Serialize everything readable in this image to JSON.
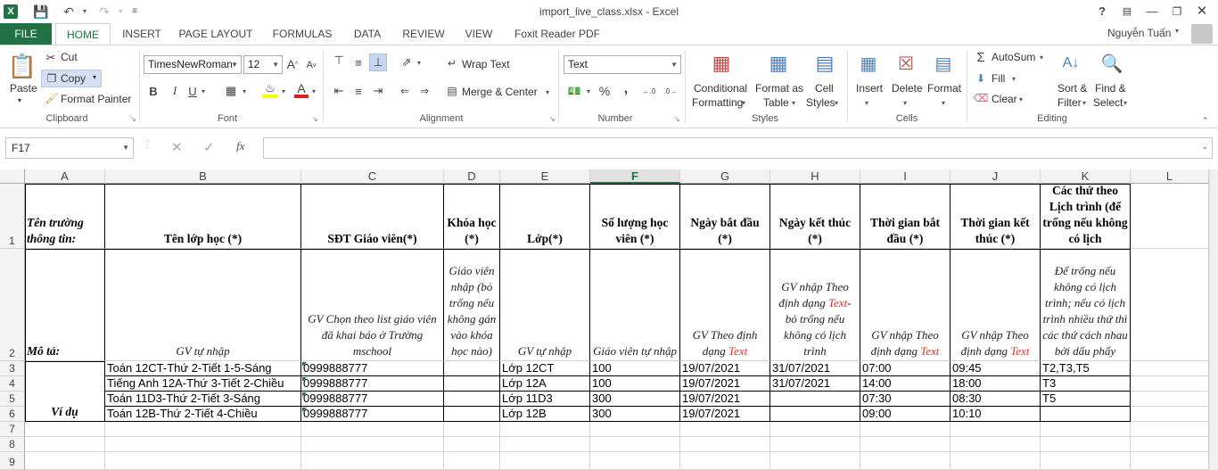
{
  "window": {
    "title": "import_live_class.xlsx - Excel",
    "help": "?",
    "user": "Nguyễn Tuấn"
  },
  "tabs": [
    "FILE",
    "HOME",
    "INSERT",
    "PAGE LAYOUT",
    "FORMULAS",
    "DATA",
    "REVIEW",
    "VIEW",
    "Foxit Reader PDF"
  ],
  "ribbon": {
    "clipboard": {
      "paste": "Paste",
      "cut": "Cut",
      "copy": "Copy",
      "format_painter": "Format Painter",
      "label": "Clipboard"
    },
    "font": {
      "family": "TimesNewRoman",
      "size": "12",
      "bold": "B",
      "italic": "I",
      "underline": "U",
      "label": "Font"
    },
    "alignment": {
      "wrap": "Wrap Text",
      "merge": "Merge & Center",
      "label": "Alignment"
    },
    "number": {
      "format": "Text",
      "percent": "%",
      "comma": ",",
      "label": "Number"
    },
    "styles": {
      "conditional": "Conditional",
      "conditional2": "Formatting",
      "format_table": "Format as",
      "format_table2": "Table",
      "cell_styles": "Cell",
      "cell_styles2": "Styles",
      "label": "Styles"
    },
    "cells": {
      "insert": "Insert",
      "delete": "Delete",
      "format": "Format",
      "label": "Cells"
    },
    "editing": {
      "autosum": "AutoSum",
      "fill": "Fill",
      "clear": "Clear",
      "sort": "Sort &",
      "sort2": "Filter",
      "find": "Find &",
      "find2": "Select",
      "label": "Editing"
    }
  },
  "formula_bar": {
    "name_box": "F17",
    "fx": "fx",
    "value": ""
  },
  "columns": [
    "A",
    "B",
    "C",
    "D",
    "E",
    "F",
    "G",
    "H",
    "I",
    "J",
    "K",
    "L"
  ],
  "rows": [
    "1",
    "2",
    "3",
    "4",
    "5",
    "6",
    "7",
    "8",
    "9"
  ],
  "header_row": {
    "A": "Tên trường thông tin:",
    "B": "Tên lớp học (*)",
    "C": "SĐT Giáo viên(*)",
    "D": "Khóa học (*)",
    "E": "Lớp(*)",
    "F": "Số lượng học viên (*)",
    "G": "Ngày bắt đầu (*)",
    "H": "Ngày kết thúc (*)",
    "I": "Thời gian bắt đầu (*)",
    "J": "Thời gian kết thúc (*)",
    "K": "Các thứ theo Lịch trình (để trống nếu không có lịch"
  },
  "desc_row": {
    "A": "Mô tả:",
    "B": "GV tự nhập",
    "C": "GV Chọn theo list giáo viên đã khai báo ở Trường mschool",
    "D": "Giáo viên nhập (bỏ trống nếu không gán vào khóa học nào)",
    "E": "GV tự nhập",
    "F": "Giáo viên tự nhập",
    "G_pre": "GV Theo định dạng",
    "G_red": "Text",
    "H_pre": "GV nhập Theo định dạng",
    "H_red": "Text",
    "H_post": "- bỏ trống nếu không có lịch trình",
    "I_pre": "GV nhập Theo định dạng",
    "I_red": "Text",
    "J_pre": "GV nhập Theo định dạng",
    "J_red": "Text",
    "K": "Để trống nếu không có lịch trình; nếu có lịch trình nhiều thứ thì các thứ cách nhau bởi dấu phẩy"
  },
  "example_label": "Ví dụ",
  "data_rows": [
    {
      "B": "Toán 12CT-Thứ 2-Tiết 1-5-Sáng",
      "C": "0999888777",
      "E": "Lớp 12CT",
      "F": "100",
      "G": "19/07/2021",
      "H": "31/07/2021",
      "I": "07:00",
      "J": "09:45",
      "K": "T2,T3,T5"
    },
    {
      "B": "Tiếng Anh 12A-Thứ 3-Tiết 2-Chiều",
      "C": "0999888777",
      "E": "Lớp 12A",
      "F": "100",
      "G": "19/07/2021",
      "H": "31/07/2021",
      "I": "14:00",
      "J": "18:00",
      "K": "T3"
    },
    {
      "B": "Toán 11D3-Thứ 2-Tiết 3-Sáng",
      "C": "0999888777",
      "E": "Lớp 11D3",
      "F": "300",
      "G": "19/07/2021",
      "H": "",
      "I": "07:30",
      "J": "08:30",
      "K": "T5"
    },
    {
      "B": "Toán 12B-Thứ 2-Tiết 4-Chiều",
      "C": "0999888777",
      "E": "Lớp 12B",
      "F": "300",
      "G": "19/07/2021",
      "H": "",
      "I": "09:00",
      "J": "10:10",
      "K": ""
    }
  ],
  "colors": {
    "excel_green": "#217346",
    "red_text": "#e03030"
  }
}
